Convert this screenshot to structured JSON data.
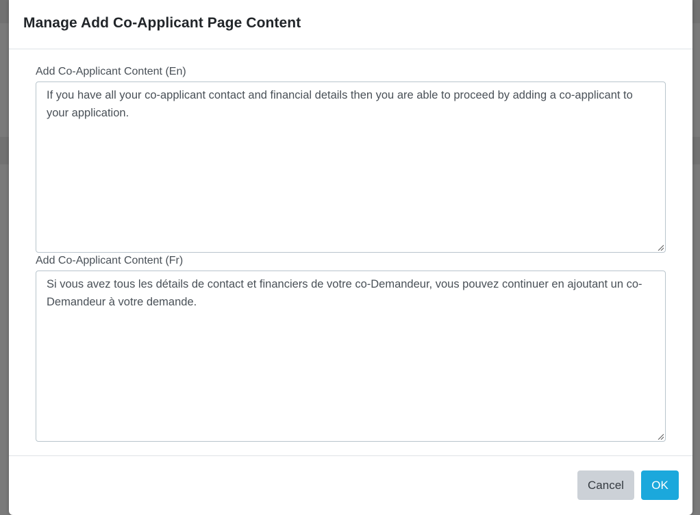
{
  "dialog": {
    "title": "Manage Add Co-Applicant Page Content",
    "fields": [
      {
        "label": "Add Co-Applicant Content (En)",
        "value": "If you have all your co-applicant contact and financial details then you are able to proceed by adding a co-applicant to your application."
      },
      {
        "label": "Add Co-Applicant Content (Fr)",
        "value": "Si vous avez tous les détails de contact et financiers de votre co-Demandeur, vous pouvez continuer en ajoutant un co-Demandeur à votre demande."
      }
    ],
    "cancel_label": "Cancel",
    "ok_label": "OK"
  },
  "colors": {
    "ok_button": "#1ba8dc",
    "cancel_button": "#ccd1d7",
    "overlay": "#6b6b6b"
  }
}
